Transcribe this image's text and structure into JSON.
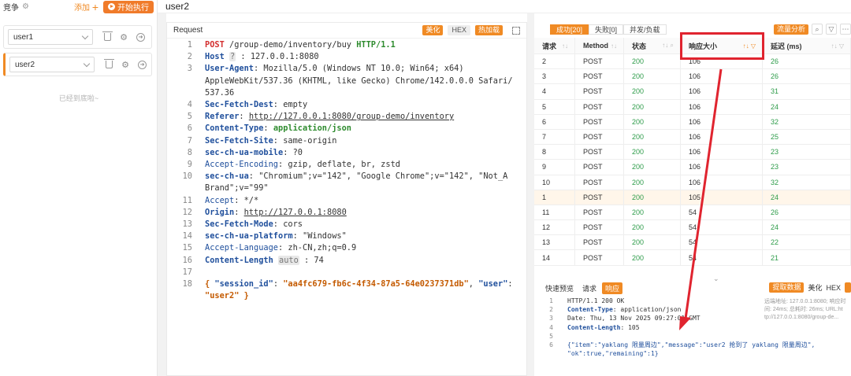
{
  "sidebar": {
    "title": "竞争",
    "add_label": "添加",
    "start_label": "开始执行",
    "users": [
      {
        "name": "user1"
      },
      {
        "name": "user2"
      }
    ],
    "empty_text": "已经到底啦~"
  },
  "active_tab": "user2",
  "request": {
    "title": "Request",
    "tools": [
      "美化",
      "HEX",
      "热加载"
    ],
    "lines": [
      "POST /group-demo/inventory/buy HTTP/1.1",
      "Host ? : 127.0.0.1:8080",
      "User-Agent: Mozilla/5.0 (Windows NT 10.0; Win64; x64) AppleWebKit/537.36 (KHTML, like Gecko) Chrome/142.0.0.0 Safari/537.36",
      "Sec-Fetch-Dest: empty",
      "Referer: http://127.0.0.1:8080/group-demo/inventory",
      "Content-Type: application/json",
      "Sec-Fetch-Site: same-origin",
      "sec-ch-ua-mobile: ?0",
      "Accept-Encoding: gzip, deflate, br, zstd",
      "sec-ch-ua: \"Chromium\";v=\"142\", \"Google Chrome\";v=\"142\", \"Not_A Brand\";v=\"99\"",
      "Accept: */*",
      "Origin: http://127.0.0.1:8080",
      "Sec-Fetch-Mode: cors",
      "sec-ch-ua-platform: \"Windows\"",
      "Accept-Language: zh-CN,zh;q=0.9",
      "Content-Length auto : 74",
      "",
      "{ \"session_id\": \"aa4fc679-fb6c-4f34-87a5-64e0237371db\", \"user\": \"user2\" }"
    ]
  },
  "results": {
    "tabs": [
      "成功[20]",
      "失败[0]",
      "并发/负载"
    ],
    "analysis_label": "流量分析",
    "columns": [
      "请求",
      "Method",
      "状态",
      "响应大小",
      "延迟 (ms)"
    ],
    "rows": [
      {
        "req": "2",
        "method": "POST",
        "status": "200",
        "size": "106",
        "delay": "26"
      },
      {
        "req": "3",
        "method": "POST",
        "status": "200",
        "size": "106",
        "delay": "26"
      },
      {
        "req": "4",
        "method": "POST",
        "status": "200",
        "size": "106",
        "delay": "31"
      },
      {
        "req": "5",
        "method": "POST",
        "status": "200",
        "size": "106",
        "delay": "24"
      },
      {
        "req": "6",
        "method": "POST",
        "status": "200",
        "size": "106",
        "delay": "32"
      },
      {
        "req": "7",
        "method": "POST",
        "status": "200",
        "size": "106",
        "delay": "25"
      },
      {
        "req": "8",
        "method": "POST",
        "status": "200",
        "size": "106",
        "delay": "23"
      },
      {
        "req": "9",
        "method": "POST",
        "status": "200",
        "size": "106",
        "delay": "23"
      },
      {
        "req": "10",
        "method": "POST",
        "status": "200",
        "size": "106",
        "delay": "32"
      },
      {
        "req": "1",
        "method": "POST",
        "status": "200",
        "size": "105",
        "delay": "24"
      },
      {
        "req": "11",
        "method": "POST",
        "status": "200",
        "size": "54",
        "delay": "26"
      },
      {
        "req": "12",
        "method": "POST",
        "status": "200",
        "size": "54",
        "delay": "24"
      },
      {
        "req": "13",
        "method": "POST",
        "status": "200",
        "size": "54",
        "delay": "22"
      },
      {
        "req": "14",
        "method": "POST",
        "status": "200",
        "size": "54",
        "delay": "21"
      }
    ]
  },
  "response": {
    "tabs": [
      "快速预览",
      "请求",
      "响应"
    ],
    "tools": [
      "提取数据",
      "美化",
      "HEX"
    ],
    "lines": [
      "HTTP/1.1 200 OK",
      "Content-Type: application/json",
      "Date: Thu, 13 Nov 2025 09:27:01 GMT",
      "Content-Length: 105",
      "",
      "{\"item\":\"yaklang 限量周边\",\"message\":\"user2 抢到了 yaklang 限量周边\",",
      "\"ok\":true,\"remaining\":1}"
    ],
    "info": [
      "远端地址: 127.0.0.1:8080; 响应时",
      "间: 24ms; 总耗时: 26ms; URL:ht",
      "tp://127.0.0.1:8080/group-de..."
    ]
  },
  "colors": {
    "accent": "#f08a24",
    "annotation": "#e0242f",
    "status_ok": "#2e9c4a"
  }
}
